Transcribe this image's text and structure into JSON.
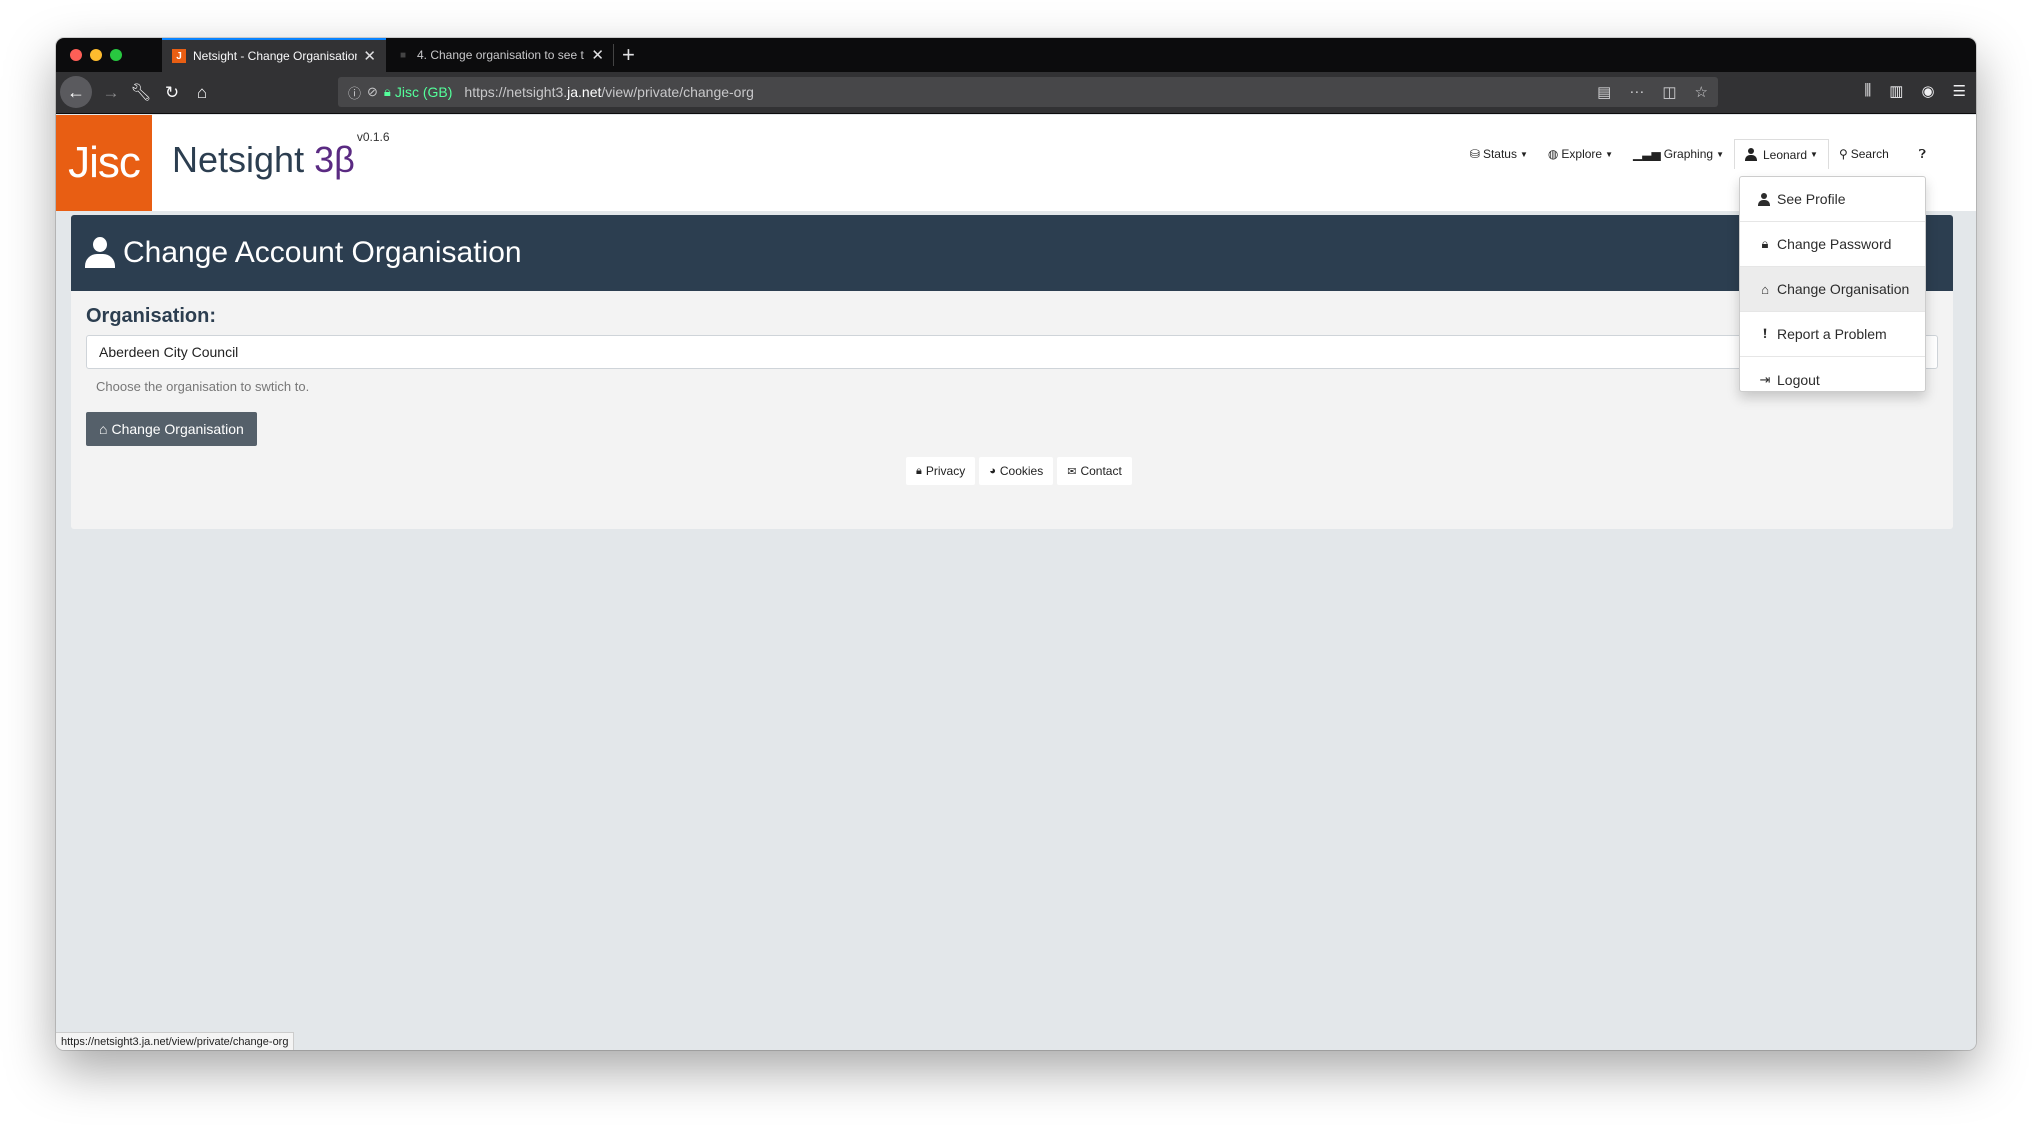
{
  "browser": {
    "tabs": [
      {
        "label": "Netsight - Change Organisation",
        "favicon": "J"
      },
      {
        "label": "4. Change organisation to see t"
      }
    ],
    "url": {
      "cert": "Jisc (GB)",
      "prefix": "https://netsight3.",
      "domain": "ja.net",
      "path": "/view/private/change-org"
    },
    "status_url": "https://netsight3.ja.net/view/private/change-org"
  },
  "site": {
    "logo": "Jisc",
    "brand": "Netsight",
    "brand_version": "3β",
    "version_sup": "v0.1.6"
  },
  "nav": {
    "status": "Status",
    "explore": "Explore",
    "graphing": "Graphing",
    "user": "Leonard",
    "search": "Search"
  },
  "user_menu": {
    "items": [
      {
        "label": "See Profile",
        "icon": "person-icon"
      },
      {
        "label": "Change Password",
        "icon": "lock-icon"
      },
      {
        "label": "Change Organisation",
        "icon": "inbox-icon"
      },
      {
        "label": "Report a Problem",
        "icon": "exclamation-icon"
      },
      {
        "label": "Logout",
        "icon": "logout-icon"
      }
    ]
  },
  "panel": {
    "title": "Change Account Organisation",
    "org_label": "Organisation:",
    "org_value": "Aberdeen City Council",
    "help": "Choose the organisation to swtich to.",
    "button": "Change Organisation"
  },
  "footer": {
    "privacy": "Privacy",
    "cookies": "Cookies",
    "contact": "Contact"
  },
  "colors": {
    "accent": "#e85e13",
    "header_dark": "#2c3e50",
    "beta": "#5a2a82",
    "button": "#55606a"
  }
}
